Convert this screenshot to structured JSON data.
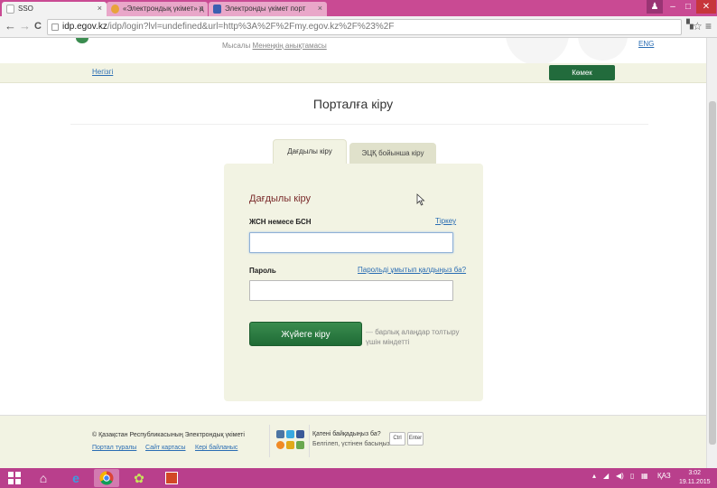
{
  "browser": {
    "tabs": [
      {
        "title": "SSO",
        "close": "×"
      },
      {
        "title": "«Электрондық үкімет» д",
        "close": "×"
      },
      {
        "title": "Электронды үкімет порт",
        "close": "×"
      }
    ],
    "window_controls": {
      "minimize": "–",
      "maximize": "□",
      "close": "✕"
    },
    "nav": {
      "back": "←",
      "forward": "→",
      "reload": "C"
    },
    "url_host": "idp.egov.kz",
    "url_path": "/idp/login?lvl=undefined&url=http%3A%2F%2Fmy.egov.kz%2F%23%2F",
    "star": "☆",
    "menu": "≡"
  },
  "header": {
    "example_prefix": "Мысалы",
    "example_link": "Менеңкің анықтамасы",
    "lang": "ENG",
    "back_link": "Негізгі",
    "help_button": "Көмек"
  },
  "page": {
    "title": "Порталға кіру"
  },
  "login_tabs": [
    {
      "label": "Дағдылы кіру",
      "active": true
    },
    {
      "label": "ЭЦҚ бойынша кіру",
      "active": false
    }
  ],
  "form": {
    "heading": "Дағдылы кіру",
    "id_label": "ЖСН немесе БСН",
    "register_link": "Тіркеу",
    "id_value": "",
    "password_label": "Пароль",
    "forgot_link": "Парольді ұмытып қалдыңыз ба?",
    "password_value": "",
    "submit": "Жүйеге кіру",
    "required_dash": "—",
    "required_note": "барлық алаңдар толтыру үшін міндетті"
  },
  "footer": {
    "copyright": "© Қазақстан Республикасының Электрондық үкіметі",
    "links": [
      "Портал туралы",
      "Сайт картасы",
      "Кері байланыс"
    ],
    "error_title": "Қатені байқадыңыз ба?",
    "error_sub": "Белгілеп, үстінен басыңыз.",
    "key1": "Ctrl",
    "key2": "Enter"
  },
  "taskbar": {
    "lang": "ҚАЗ",
    "time": "3:02",
    "date": "19.11.2015"
  },
  "colors": {
    "tabbar": "#c94a93",
    "taskbar": "#b93f8c",
    "green": "#226b3c",
    "panel": "#f2f3e3",
    "heading": "#7a2b2b",
    "link": "#2a6db3"
  }
}
